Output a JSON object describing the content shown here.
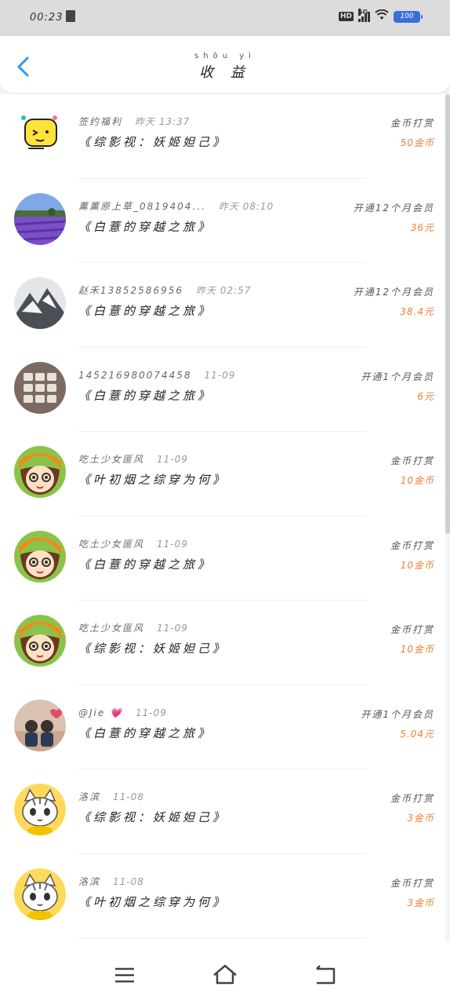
{
  "status_bar": {
    "time": "00:23",
    "network": "5G",
    "hd": "HD",
    "battery": "100"
  },
  "header": {
    "title_pinyin": "shōu yì",
    "title": "收 益"
  },
  "records": [
    {
      "name": "签约福利",
      "time": "昨天 13:37",
      "book": "《综影视：妖姬妲己》",
      "action": "金币打赏",
      "amount": "50金币"
    },
    {
      "name": "薰薰原上草_0819404...",
      "time": "昨天 08:10",
      "book": "《白薏的穿越之旅》",
      "action": "开通12个月会员",
      "amount": "36元"
    },
    {
      "name": "赵禾13852586956",
      "time": "昨天 02:57",
      "book": "《白薏的穿越之旅》",
      "action": "开通12个月会员",
      "amount": "38.4元"
    },
    {
      "name": "145216980074458",
      "time": "11-09",
      "book": "《白薏的穿越之旅》",
      "action": "开通1个月会员",
      "amount": "6元"
    },
    {
      "name": "吃土少女匪风",
      "time": "11-09",
      "book": "《叶初烟之综穿为何》",
      "action": "金币打赏",
      "amount": "10金币"
    },
    {
      "name": "吃土少女匪风",
      "time": "11-09",
      "book": "《白薏的穿越之旅》",
      "action": "金币打赏",
      "amount": "10金币"
    },
    {
      "name": "吃土少女匪风",
      "time": "11-09",
      "book": "《综影视：妖姬妲己》",
      "action": "金币打赏",
      "amount": "10金币"
    },
    {
      "name": "@Jie 💗",
      "time": "11-09",
      "book": "《白薏的穿越之旅》",
      "action": "开通1个月会员",
      "amount": "5.04元"
    },
    {
      "name": "洛滨",
      "time": "11-08",
      "book": "《综影视：妖姬妲己》",
      "action": "金币打赏",
      "amount": "3金币"
    },
    {
      "name": "洛滨",
      "time": "11-08",
      "book": "《叶初烟之综穿为何》",
      "action": "金币打赏",
      "amount": "3金币"
    }
  ],
  "avatar_icons": [
    "emoji-sticker-icon",
    "lavender-field-icon",
    "mountain-ink-icon",
    "tile-grid-icon",
    "cartoon-girl-icon",
    "cartoon-girl-icon",
    "cartoon-girl-icon",
    "couple-photo-icon",
    "cartoon-cat-icon",
    "cartoon-cat-icon"
  ],
  "colors": {
    "accent_blue": "#2f9ae8",
    "amount_orange": "#f07d33",
    "status_bar": "#dcdcdc"
  },
  "nav": {
    "icons": [
      "menu-icon",
      "home-icon",
      "back-icon"
    ]
  }
}
